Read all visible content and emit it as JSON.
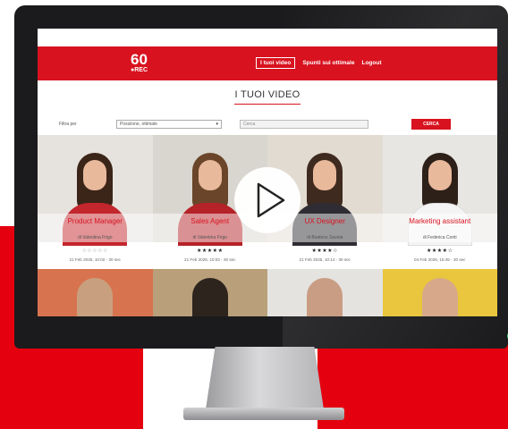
{
  "app": {
    "logo_number": "60",
    "logo_suffix": "●REC",
    "nav": [
      {
        "label": "I tuoi video",
        "active": true
      },
      {
        "label": "Spunti sui ottimale",
        "active": false
      },
      {
        "label": "Logout",
        "active": false
      }
    ]
  },
  "page": {
    "title": "I TUOI VIDEO"
  },
  "filters": {
    "label": "Filtra per",
    "select_value": "Posizione, ottimale",
    "search_placeholder": "Cerca",
    "search_button": "CERCA"
  },
  "cards": [
    {
      "role": "Product Manager",
      "author": "di Valentina Frigo",
      "rating": "☆☆☆☆☆",
      "rating_value": 0,
      "date": "21 Feb 2025, 10:02 - 30 sec",
      "colors": {
        "bg": "#e6e3de",
        "hair": "#3b2418",
        "body": "#c3262c"
      }
    },
    {
      "role": "Sales Agent",
      "author": "di Valentina Frigo",
      "rating": "★★★★★",
      "rating_value": 5,
      "date": "21 Feb 2025, 10:03 - 30 sec",
      "colors": {
        "bg": "#d9d6d0",
        "hair": "#6b4529",
        "body": "#b52227"
      }
    },
    {
      "role": "UX Designer",
      "author": "di Beatrice Savoia",
      "rating": "★★★★☆",
      "rating_value": 4,
      "date": "21 Feb 2025, 10:14 - 30 sec",
      "colors": {
        "bg": "#e2dbd2",
        "hair": "#3f2a1f",
        "body": "#2f2d33"
      }
    },
    {
      "role": "Marketing assistant",
      "author": "di Federica Conti",
      "rating": "★★★★☆",
      "rating_value": 4,
      "date": "04 Feb 2025, 15:45 - 30 sec",
      "colors": {
        "bg": "#e8e6e2",
        "hair": "#2d2019",
        "body": "#ffffff"
      }
    }
  ],
  "cards_row2": [
    {
      "colors": {
        "bg": "#d8734f",
        "head": "#c9a07f"
      }
    },
    {
      "colors": {
        "bg": "#b9a07a",
        "head": "#2e241e"
      }
    },
    {
      "colors": {
        "bg": "#e4e3e0",
        "head": "#c99d83"
      }
    },
    {
      "colors": {
        "bg": "#e9c63d",
        "head": "#d7a98a"
      }
    }
  ],
  "theme": {
    "accent": "#d8121f",
    "power_led": "#3bd36a"
  }
}
